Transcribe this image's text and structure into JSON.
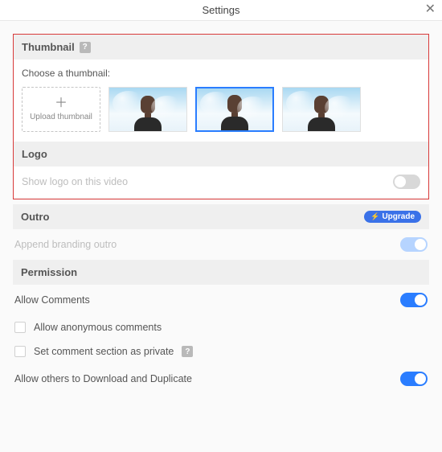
{
  "modal": {
    "title": "Settings"
  },
  "thumbnail": {
    "header": "Thumbnail",
    "choose_label": "Choose a thumbnail:",
    "upload_label": "Upload thumbnail"
  },
  "logo": {
    "header": "Logo",
    "show_label": "Show logo on this video",
    "enabled": false
  },
  "outro": {
    "header": "Outro",
    "upgrade_label": "Upgrade",
    "append_label": "Append branding outro",
    "enabled": true,
    "disabled_ui": true
  },
  "permission": {
    "header": "Permission",
    "allow_comments_label": "Allow Comments",
    "allow_comments": true,
    "allow_anonymous_label": "Allow anonymous comments",
    "allow_anonymous": false,
    "private_label": "Set comment section as private",
    "private": false,
    "download_label": "Allow others to Download and Duplicate",
    "download": true
  }
}
